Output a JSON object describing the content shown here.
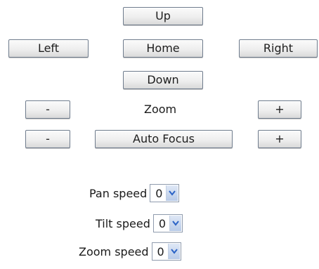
{
  "ptz": {
    "up": "Up",
    "left": "Left",
    "home": "Home",
    "right": "Right",
    "down": "Down"
  },
  "zoom": {
    "minus": "-",
    "label": "Zoom",
    "plus": "+"
  },
  "focus": {
    "minus": "-",
    "label": "Auto Focus",
    "plus": "+"
  },
  "speeds": {
    "pan": {
      "label": "Pan speed",
      "value": "0"
    },
    "tilt": {
      "label": "Tilt speed",
      "value": "0"
    },
    "zoom": {
      "label": "Zoom speed",
      "value": "0"
    }
  },
  "colors": {
    "arrow": "#2b63c6"
  }
}
